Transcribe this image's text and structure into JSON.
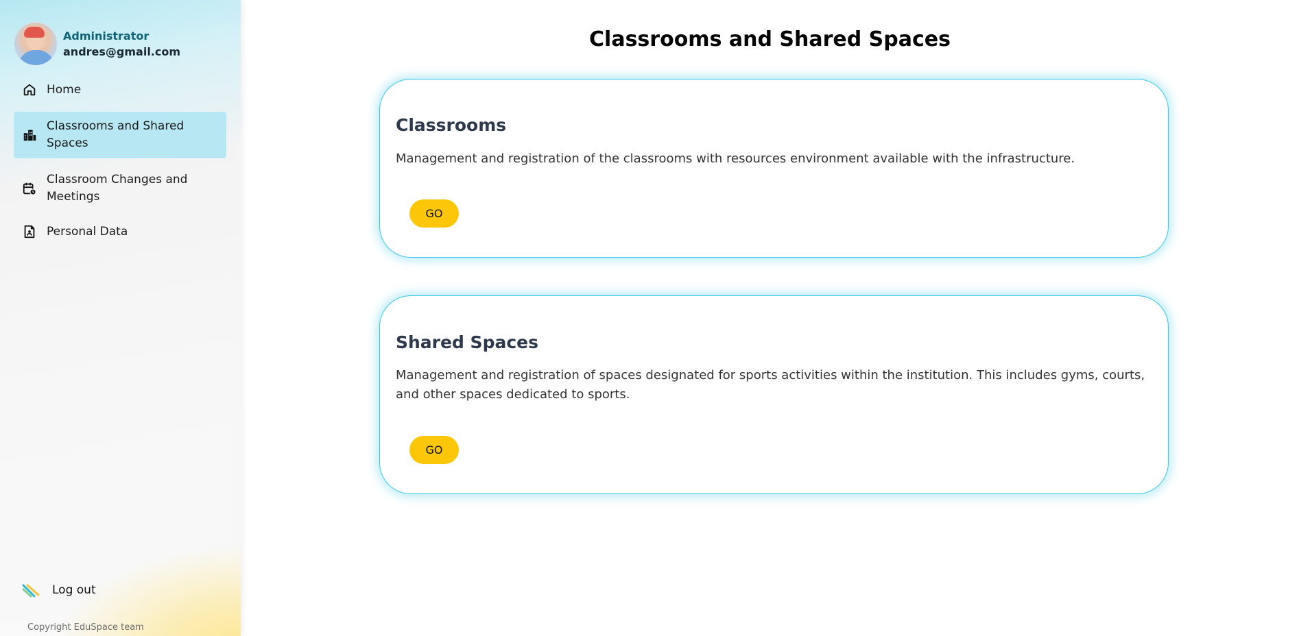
{
  "user": {
    "role": "Administrator",
    "email": "andres@gmail.com"
  },
  "nav": {
    "items": [
      {
        "label": "Home",
        "icon": "home-icon"
      },
      {
        "label": "Classrooms and Shared Spaces",
        "icon": "building-icon",
        "active": true
      },
      {
        "label": "Classroom Changes and Meetings",
        "icon": "calendar-clock-icon"
      },
      {
        "label": "Personal Data",
        "icon": "document-user-icon"
      }
    ],
    "logout": "Log out"
  },
  "footer": {
    "copyright": "Copyright EduSpace team"
  },
  "main": {
    "title": "Classrooms and Shared Spaces",
    "cards": [
      {
        "title": "Classrooms",
        "description": "Management and registration of the classrooms with resources environment available with the infrastructure.",
        "button": "GO"
      },
      {
        "title": "Shared Spaces",
        "description": "Management and registration of spaces designated for sports activities within the institution. This includes gyms, courts, and other spaces dedicated to sports.",
        "button": "GO"
      }
    ]
  },
  "colors": {
    "accent": "#36c7e6",
    "active_nav": "#b6e7f2",
    "button": "#fcc708",
    "role_text": "#0e6475"
  }
}
